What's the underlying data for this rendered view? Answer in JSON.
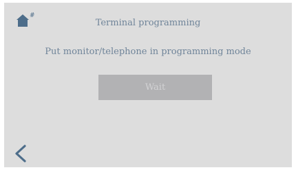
{
  "header": {
    "home_icon": "home-icon",
    "home_badge": "#",
    "title": "Terminal programming"
  },
  "main": {
    "instruction": "Put monitor/telephone in programming mode",
    "wait_label": "Wait"
  },
  "footer": {
    "back_icon": "chevron-left-icon"
  },
  "colors": {
    "background": "#dddddd",
    "accent": "#4d6d8a",
    "text": "#6f8499",
    "button_bg": "#b2b2b4",
    "button_text": "#d2d2d4"
  }
}
